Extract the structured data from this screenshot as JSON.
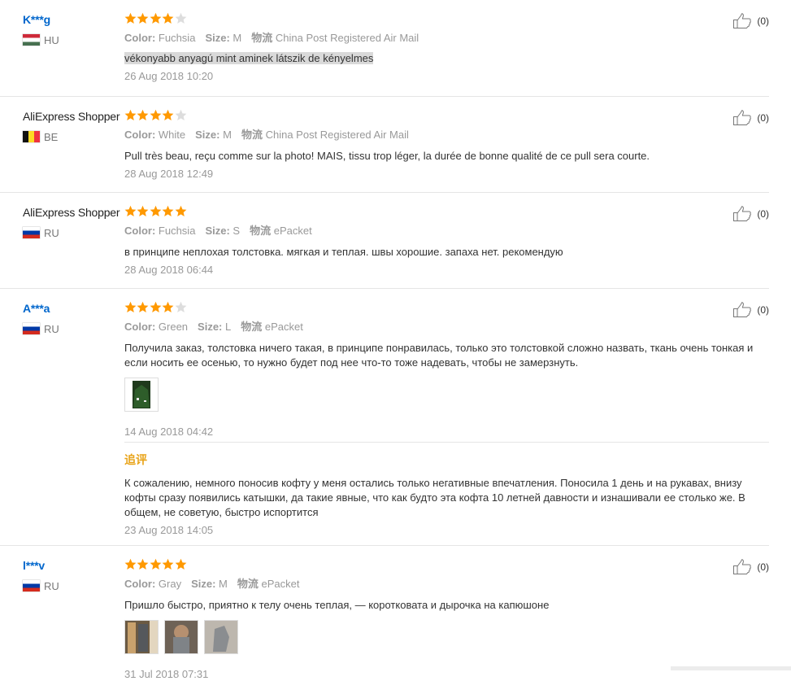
{
  "reviews": [
    {
      "name": "K***g",
      "name_link": true,
      "flag": "hu",
      "country": "HU",
      "stars": 4,
      "color_label": "Color:",
      "color": "Fuchsia",
      "size_label": "Size:",
      "size": "M",
      "ship_label": "物流",
      "ship": "China Post Registered Air Mail",
      "text": "vékonyabb anyagú mint aminek látszik de kényelmes",
      "date": "26 Aug 2018 10:20",
      "likes": "(0)"
    },
    {
      "name": "AliExpress Shopper",
      "name_link": false,
      "flag": "be",
      "country": "BE",
      "stars": 4,
      "color_label": "Color:",
      "color": "White",
      "size_label": "Size:",
      "size": "M",
      "ship_label": "物流",
      "ship": "China Post Registered Air Mail",
      "text": "Pull très beau, reçu comme sur la photo! MAIS, tissu trop léger, la durée de bonne qualité de ce pull sera courte.",
      "date": "28 Aug 2018 12:49",
      "likes": "(0)"
    },
    {
      "name": "AliExpress Shopper",
      "name_link": false,
      "flag": "ru",
      "country": "RU",
      "stars": 5,
      "color_label": "Color:",
      "color": "Fuchsia",
      "size_label": "Size:",
      "size": "S",
      "ship_label": "物流",
      "ship": "ePacket",
      "text": "в принципе неплохая толстовка. мягкая и теплая. швы хорошие. запаха нет. рекомендую",
      "date": "28 Aug 2018 06:44",
      "likes": "(0)"
    },
    {
      "name": "A***a",
      "name_link": true,
      "flag": "ru",
      "country": "RU",
      "stars": 4,
      "color_label": "Color:",
      "color": "Green",
      "size_label": "Size:",
      "size": "L",
      "ship_label": "物流",
      "ship": "ePacket",
      "text": "Получила заказ, толстовка ничего такая, в принципе понравилась, только это толстовкой сложно назвать, ткань очень тонкая и если носить ее осенью, то нужно будет под нее что-то тоже надевать, чтобы не замерзнуть.",
      "date": "14 Aug 2018 04:42",
      "likes": "(0)",
      "additional_title": "追评",
      "additional_text": "К сожалению, немного поносив кофту у меня остались только негативные впечатления. Поносила 1 день и на рукавах, внизу кофты сразу появились катышки, да такие явные, что как будто эта кофта 10 летней давности и изнашивали ее столько же. В общем, не советую, быстро испортится",
      "additional_date": "23 Aug 2018 14:05"
    },
    {
      "name": "l***v",
      "name_link": true,
      "flag": "ru",
      "country": "RU",
      "stars": 5,
      "color_label": "Color:",
      "color": "Gray",
      "size_label": "Size:",
      "size": "M",
      "ship_label": "物流",
      "ship": "ePacket",
      "text": "Пришло быстро, приятно к телу очень теплая, — коротковата и дырочка на капюшоне",
      "date": "31 Jul 2018 07:31",
      "likes": "(0)"
    }
  ],
  "colors": {
    "star": "#ff9900",
    "star_empty": "#dddddd",
    "link": "#0066cc",
    "additional": "#e8a317"
  }
}
